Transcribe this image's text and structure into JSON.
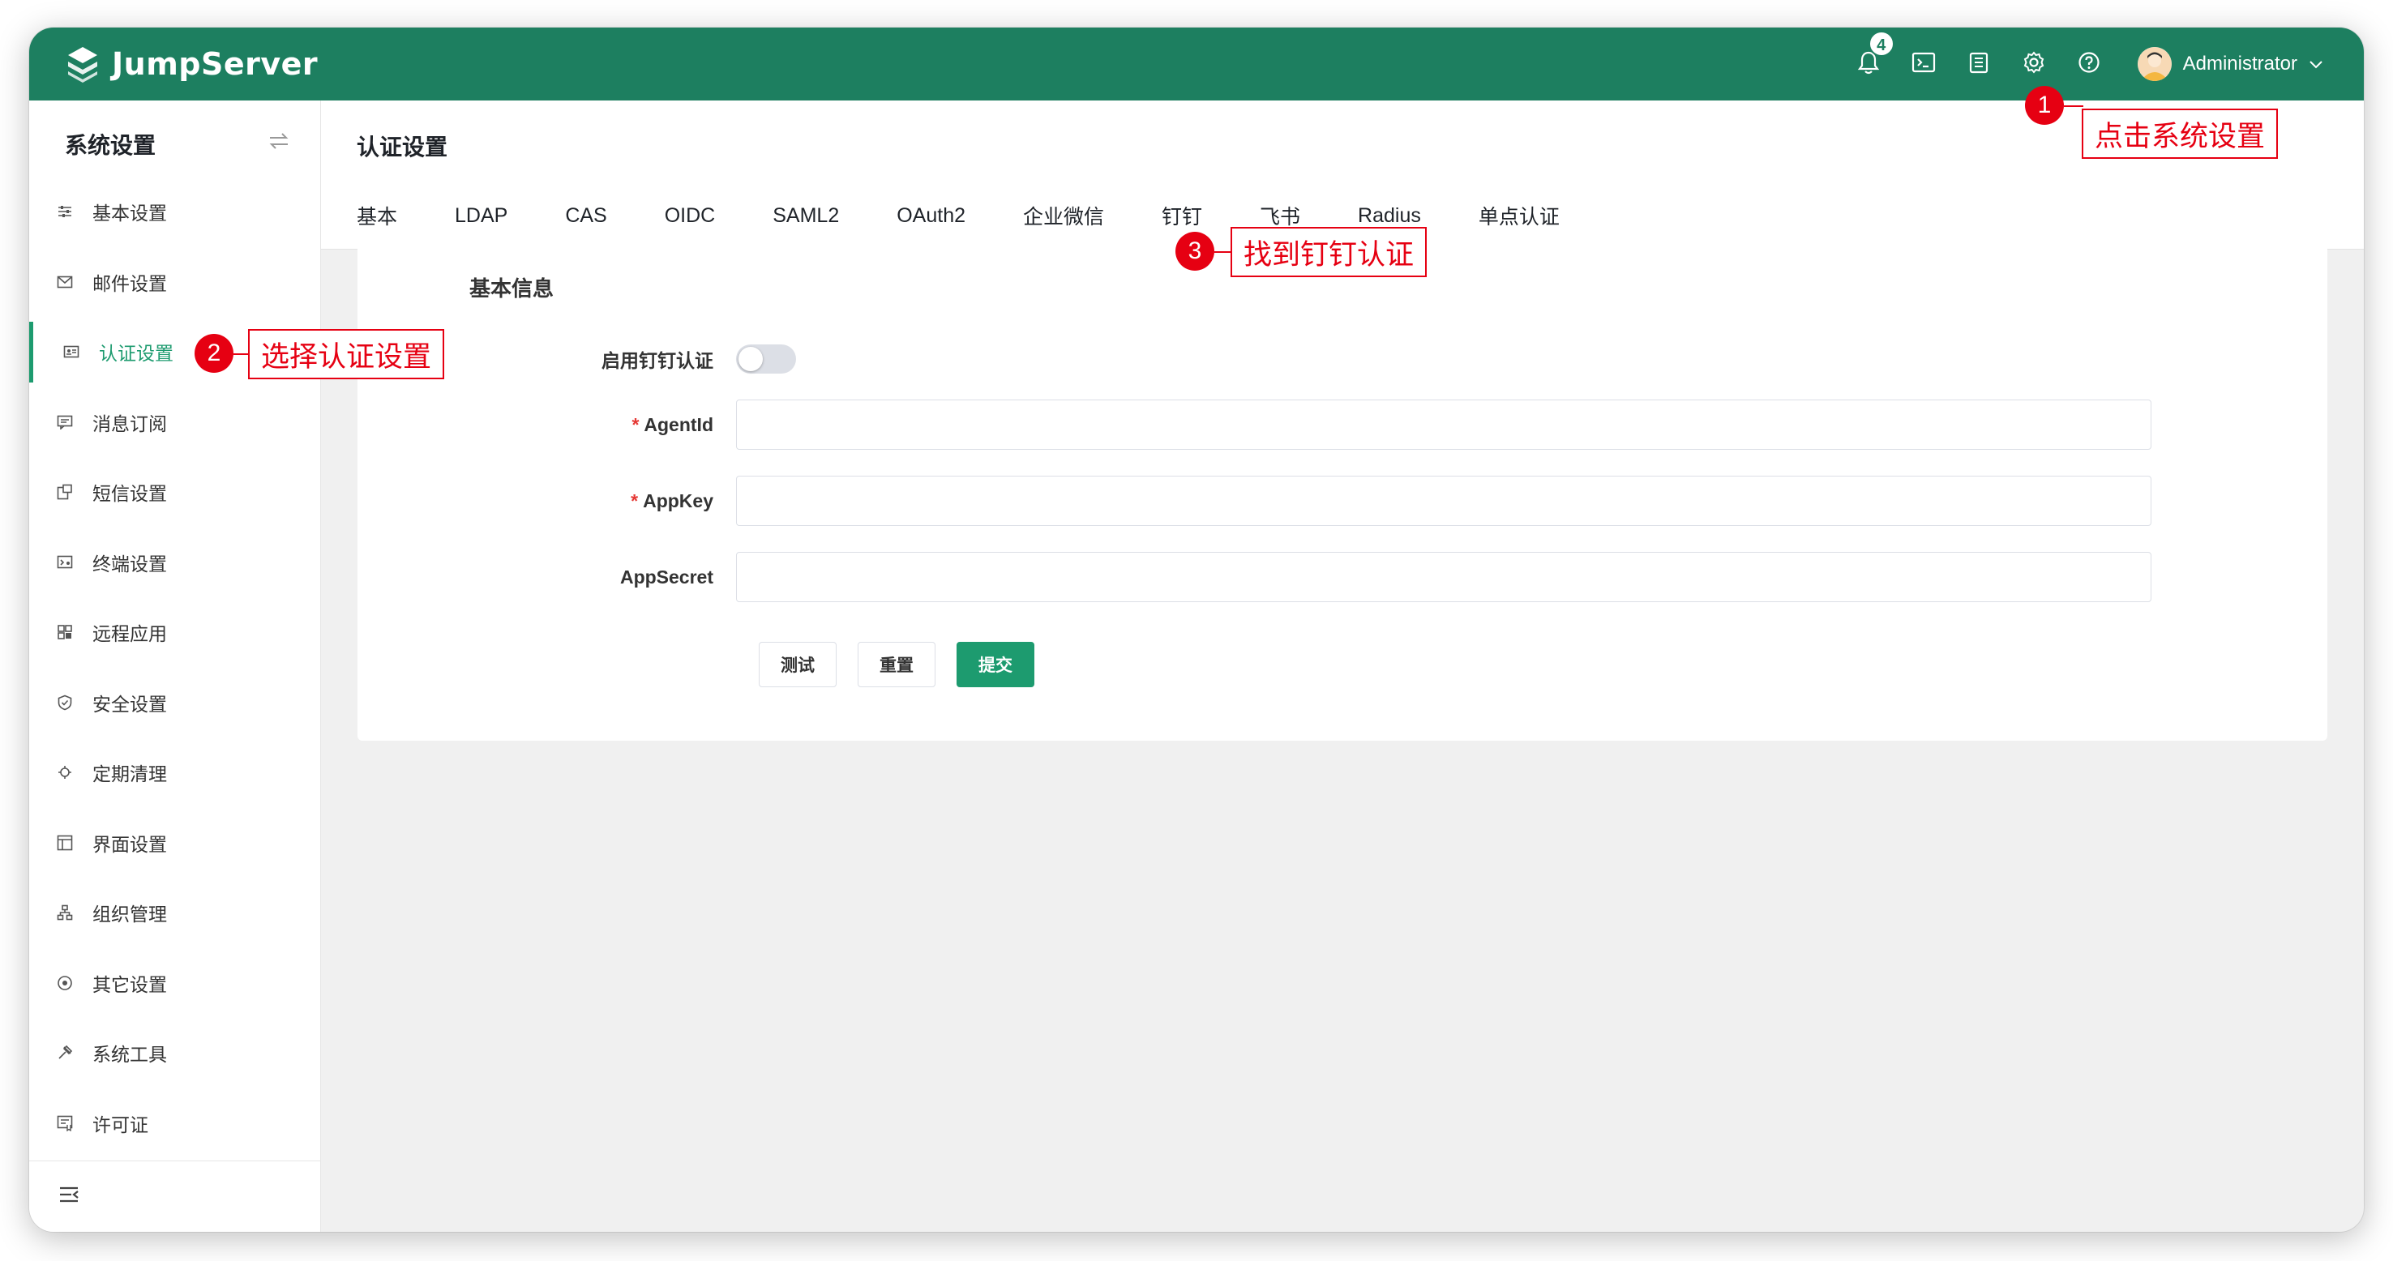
{
  "app": {
    "logo_text": "JumpServer"
  },
  "header": {
    "notification_count": "4",
    "user_name": "Administrator",
    "icons": [
      "bell-icon",
      "terminal-icon",
      "document-icon",
      "gear-icon",
      "help-icon"
    ]
  },
  "sidebar": {
    "title": "系统设置",
    "items": [
      {
        "label": "基本设置",
        "icon": "sliders-icon"
      },
      {
        "label": "邮件设置",
        "icon": "mail-icon"
      },
      {
        "label": "认证设置",
        "icon": "id-card-icon",
        "active": true
      },
      {
        "label": "消息订阅",
        "icon": "message-icon"
      },
      {
        "label": "短信设置",
        "icon": "sms-icon"
      },
      {
        "label": "终端设置",
        "icon": "terminal-settings-icon"
      },
      {
        "label": "远程应用",
        "icon": "apps-icon"
      },
      {
        "label": "安全设置",
        "icon": "shield-icon"
      },
      {
        "label": "定期清理",
        "icon": "clean-icon"
      },
      {
        "label": "界面设置",
        "icon": "layout-icon"
      },
      {
        "label": "组织管理",
        "icon": "org-icon"
      },
      {
        "label": "其它设置",
        "icon": "other-icon"
      },
      {
        "label": "系统工具",
        "icon": "tools-icon"
      },
      {
        "label": "许可证",
        "icon": "license-icon"
      }
    ]
  },
  "main": {
    "page_title": "认证设置",
    "tabs": [
      "基本",
      "LDAP",
      "CAS",
      "OIDC",
      "SAML2",
      "OAuth2",
      "企业微信",
      "钉钉",
      "飞书",
      "Radius",
      "单点认证"
    ],
    "active_tab": "钉钉",
    "section_title": "基本信息",
    "form": {
      "enable_label": "启用钉钉认证",
      "enable_value": false,
      "agentid_label": "AgentId",
      "agentid_value": "",
      "appkey_label": "AppKey",
      "appkey_value": "",
      "appsecret_label": "AppSecret",
      "appsecret_value": "",
      "required_mark": "*"
    },
    "buttons": {
      "test": "测试",
      "reset": "重置",
      "submit": "提交"
    }
  },
  "annotations": [
    {
      "number": "1",
      "text": "点击系统设置"
    },
    {
      "number": "2",
      "text": "选择认证设置"
    },
    {
      "number": "3",
      "text": "找到钉钉认证"
    }
  ],
  "colors": {
    "brand": "#1d7f60",
    "accent": "#1d9b6f",
    "annotation": "#e60012"
  }
}
